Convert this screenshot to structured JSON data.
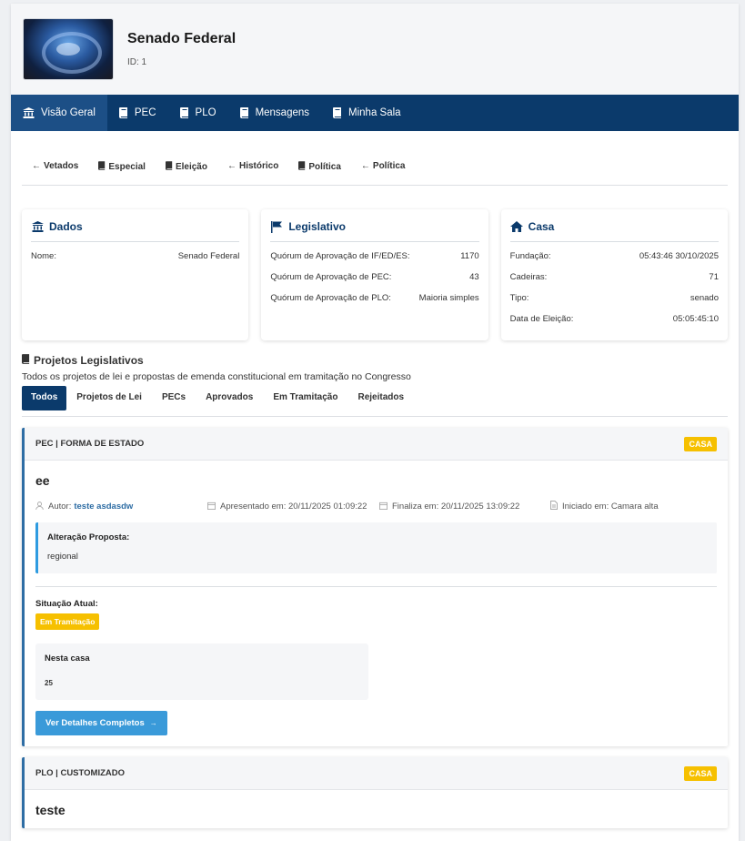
{
  "header": {
    "title": "Senado Federal",
    "id_label": "ID: 1"
  },
  "nav": [
    {
      "label": "Visão Geral",
      "icon": "bank-icon"
    },
    {
      "label": "PEC",
      "icon": "book-icon"
    },
    {
      "label": "PLO",
      "icon": "book-icon"
    },
    {
      "label": "Mensagens",
      "icon": "book-icon"
    },
    {
      "label": "Minha Sala",
      "icon": "book-icon"
    }
  ],
  "subnav": [
    {
      "label": "Vetados",
      "icon": "arrow-left-icon"
    },
    {
      "label": "Especial",
      "icon": "book-icon"
    },
    {
      "label": "Eleição",
      "icon": "book-icon"
    },
    {
      "label": "Histórico",
      "icon": "arrow-left-icon"
    },
    {
      "label": "Política",
      "icon": "book-icon"
    },
    {
      "label": "Política",
      "icon": "arrow-left-icon"
    }
  ],
  "cards": {
    "dados": {
      "title": "Dados",
      "rows": [
        {
          "k": "Nome:",
          "v": "Senado Federal"
        }
      ]
    },
    "legislativo": {
      "title": "Legislativo",
      "rows": [
        {
          "k": "Quórum de Aprovação de IF/ED/ES:",
          "v": "1170"
        },
        {
          "k": "Quórum de Aprovação de PEC:",
          "v": "43"
        },
        {
          "k": "Quórum de Aprovação de PLO:",
          "v": "Maioria simples"
        }
      ]
    },
    "casa": {
      "title": "Casa",
      "rows": [
        {
          "k": "Fundação:",
          "v": "05:43:46 30/10/2025"
        },
        {
          "k": "Cadeiras:",
          "v": "71"
        },
        {
          "k": "Tipo:",
          "v": "senado"
        },
        {
          "k": "Data de Eleição:",
          "v": "05:05:45:10"
        }
      ]
    }
  },
  "projects_section": {
    "title": "Projetos Legislativos",
    "description": "Todos os projetos de lei e propostas de emenda constitucional em tramitação no Congresso",
    "filters": [
      "Todos",
      "Projetos de Lei",
      "PECs",
      "Aprovados",
      "Em Tramitação",
      "Rejeitados"
    ]
  },
  "projects": [
    {
      "type": "PEC | FORMA DE ESTADO",
      "badge": "CASA",
      "title": "ee",
      "author_label": "Autor:",
      "author": "teste asdasdw",
      "presented": "Apresentado em: 20/11/2025 01:09:22",
      "ends": "Finaliza em: 20/11/2025 13:09:22",
      "started": "Iniciado em: Camara alta",
      "proposal_label": "Alteração Proposta:",
      "proposal_value": "regional",
      "status_label": "Situação Atual:",
      "status": "Em Tramitação",
      "house_label": "Nesta casa",
      "house_value": "25",
      "details_button": "Ver Detalhes Completos"
    },
    {
      "type": "PLO | CUSTOMIZADO",
      "badge": "CASA",
      "title": "teste"
    }
  ],
  "colors": {
    "navbar": "#0b3a6b",
    "accent_blue": "#2e6da4",
    "badge_yellow": "#f6c000",
    "button_blue": "#3a9ad9"
  }
}
